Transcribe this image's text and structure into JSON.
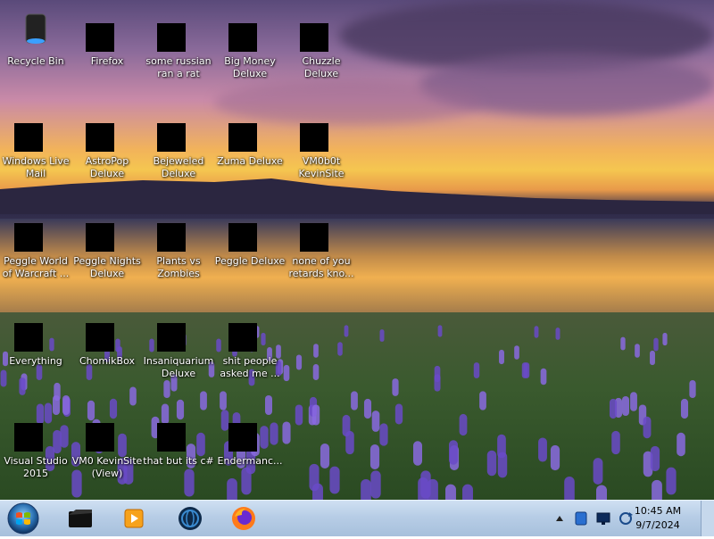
{
  "colors": {
    "taskbar": "#b7cde6",
    "label_text": "#ffffff"
  },
  "desktop_icons": [
    {
      "label": "Recycle Bin",
      "icon": "recycle-bin-icon"
    },
    {
      "label": "Windows Live Mail",
      "icon": "mail-icon"
    },
    {
      "label": "Peggle World of Warcraft ...",
      "icon": "game-icon"
    },
    {
      "label": "Everything",
      "icon": "search-app-icon"
    },
    {
      "label": "Visual Studio 2015",
      "icon": "visual-studio-icon"
    },
    {
      "label": "Firefox",
      "icon": "firefox-icon"
    },
    {
      "label": "AstroPop Deluxe",
      "icon": "game-icon"
    },
    {
      "label": "Peggle Nights Deluxe",
      "icon": "game-icon"
    },
    {
      "label": "ChomikBox",
      "icon": "chomikbox-icon"
    },
    {
      "label": "VM0 KevinSite (View)",
      "icon": "app-icon"
    },
    {
      "label": "some russian ran a rat",
      "icon": "app-icon"
    },
    {
      "label": "Bejeweled Deluxe",
      "icon": "gem-icon"
    },
    {
      "label": "Plants vs Zombies",
      "icon": "game-icon"
    },
    {
      "label": "Insaniquarium Deluxe",
      "icon": "fish-icon"
    },
    {
      "label": "that but its c#",
      "icon": "files-icon"
    },
    {
      "label": "Big Money Deluxe",
      "icon": "game-icon"
    },
    {
      "label": "Zuma Deluxe",
      "icon": "game-icon"
    },
    {
      "label": "Peggle Deluxe",
      "icon": "game-icon"
    },
    {
      "label": "shit people asked me ...",
      "icon": "file-icon"
    },
    {
      "label": "Endermanc...",
      "icon": "app-icon"
    },
    {
      "label": "Chuzzle Deluxe",
      "icon": "game-icon"
    },
    {
      "label": "VM0b0t KevinSite",
      "icon": "app-icon"
    },
    {
      "label": "none of you retards kno...",
      "icon": "game-icon"
    }
  ],
  "taskbar": {
    "pinned": [
      {
        "name": "terminal",
        "icon": "terminal-icon"
      },
      {
        "name": "media-player",
        "icon": "media-player-icon"
      },
      {
        "name": "globe-app",
        "icon": "globe-icon"
      },
      {
        "name": "firefox",
        "icon": "firefox-icon"
      }
    ],
    "tray_icons": [
      "chevron-up-icon",
      "network-icon",
      "monitor-icon",
      "sync-icon"
    ],
    "time": "10:45 AM",
    "date": "9/7/2024"
  }
}
